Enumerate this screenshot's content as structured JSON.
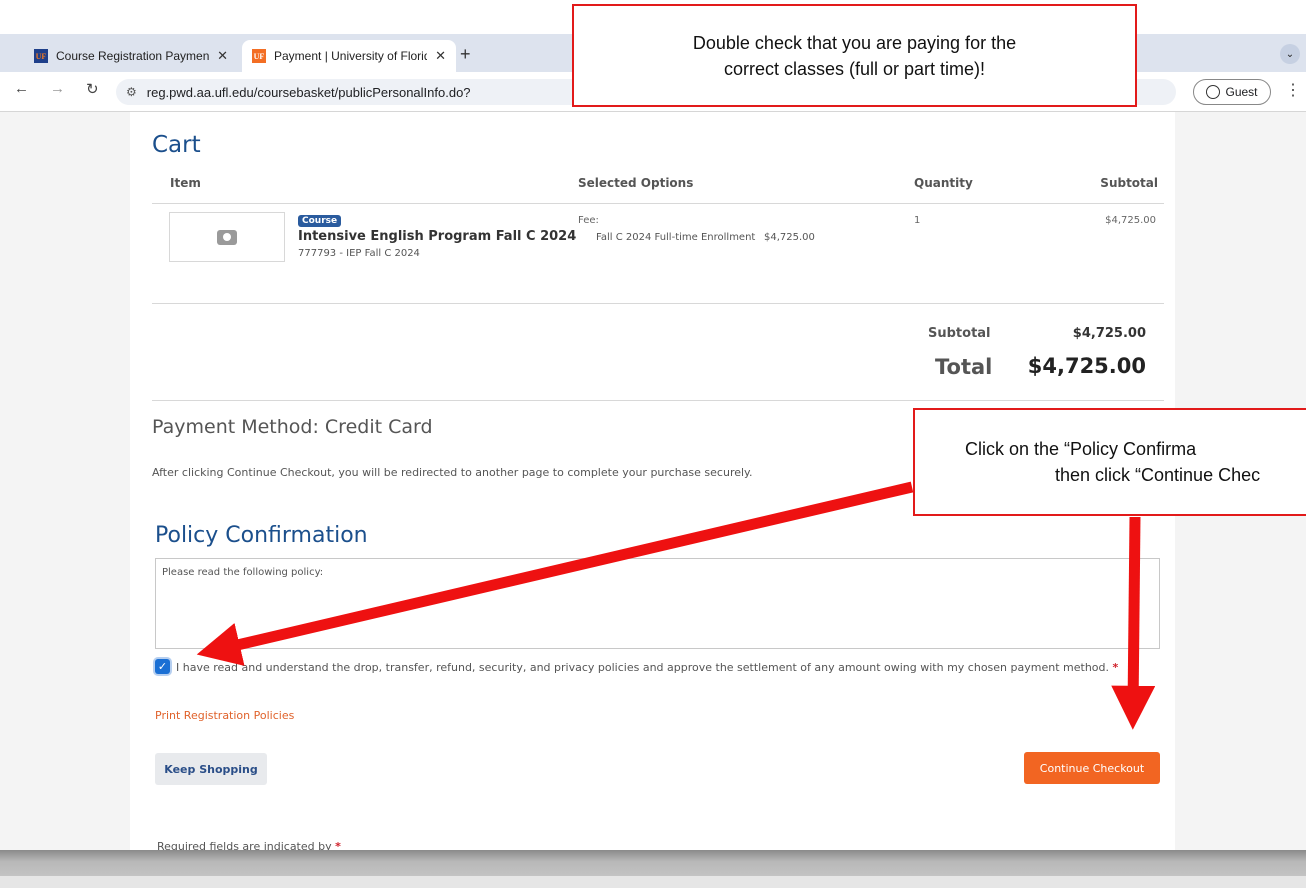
{
  "browser": {
    "tabs": [
      {
        "label": "Course Registration Payment",
        "favicon": "UF"
      },
      {
        "label": "Payment | University of Florid",
        "favicon": "UF"
      }
    ],
    "new_tab_icon": "plus-icon",
    "url": "reg.pwd.aa.ufl.edu/coursebasket/publicPersonalInfo.do?",
    "guest_label": "Guest"
  },
  "callouts": {
    "top_line1": "Double check that you are paying for the",
    "top_line2": "correct classes (full or part time)!",
    "right_line1": "Click on the “Policy Confirma",
    "right_line2": "then click “Continue Chec"
  },
  "cart": {
    "title": "Cart",
    "headers": {
      "item": "Item",
      "options": "Selected Options",
      "quantity": "Quantity",
      "subtotal": "Subtotal"
    },
    "row": {
      "badge": "Course",
      "name": "Intensive English Program Fall C 2024",
      "code": "777793 - IEP Fall C 2024",
      "fee_label": "Fee:",
      "fee_option": "Fall C 2024 Full-time Enrollment",
      "fee_amount": "$4,725.00",
      "quantity": "1",
      "subtotal": "$4,725.00"
    },
    "summary": {
      "subtotal_label": "Subtotal",
      "subtotal_value": "$4,725.00",
      "total_label": "Total",
      "total_value": "$4,725.00"
    }
  },
  "payment": {
    "title": "Payment Method: Credit Card",
    "note": "After clicking Continue Checkout, you will be redirected to another page to complete your purchase securely."
  },
  "policy": {
    "title": "Policy Confirmation",
    "box_text": "Please read the following policy:",
    "agree_text": "I have read and understand the drop, transfer, refund, security, and privacy policies and approve the settlement of any amount owing with my chosen payment method.",
    "agree_checked": true,
    "required_mark": "*",
    "print_link": "Print Registration Policies"
  },
  "actions": {
    "keep_shopping": "Keep Shopping",
    "continue_checkout": "Continue Checkout"
  },
  "footer_note": "Required fields are indicated by",
  "colors": {
    "accent_blue": "#1b4f8c",
    "checkout_orange": "#f26522",
    "callout_red": "#e21a1a"
  }
}
